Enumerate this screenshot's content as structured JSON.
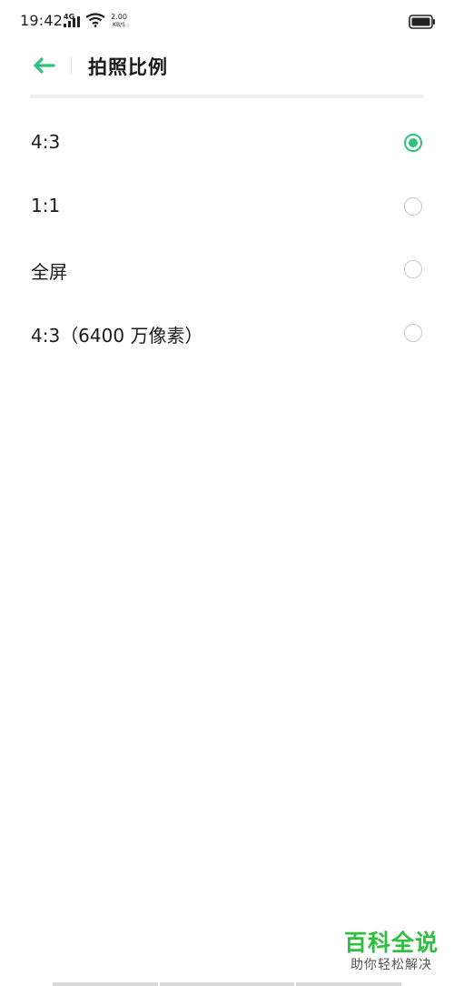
{
  "status_bar": {
    "time": "19:42",
    "network_type": "4G",
    "speed_value": "2.00",
    "speed_unit": "KB/S",
    "icons": [
      "signal-icon",
      "wifi-icon",
      "battery-icon"
    ]
  },
  "header": {
    "back_icon": "arrow-left-icon",
    "title": "拍照比例"
  },
  "options": [
    {
      "label": "4:3",
      "selected": true
    },
    {
      "label": "1:1",
      "selected": false
    },
    {
      "label": "全屏",
      "selected": false
    },
    {
      "label": "4:3（6400 万像素）",
      "selected": false
    }
  ],
  "watermark": {
    "title": "百科全说",
    "subtitle": "助你轻松解决"
  },
  "colors": {
    "accent": "#2fc27c",
    "watermark_green": "#2fbf3f",
    "radio_unselected": "#c8c8c8"
  }
}
